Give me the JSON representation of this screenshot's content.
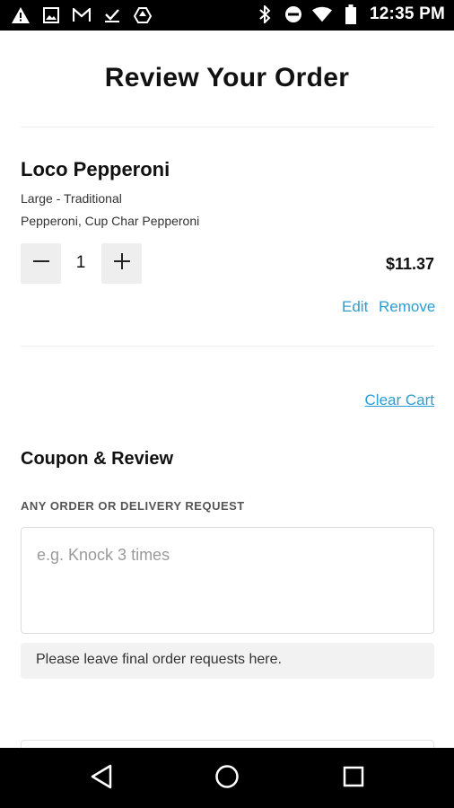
{
  "status_bar": {
    "time": "12:35 PM",
    "left_icons": [
      "warning-icon",
      "image-icon",
      "gmail-icon",
      "task-done-icon",
      "drive-icon"
    ],
    "right_icons": [
      "bluetooth-icon",
      "do-not-disturb-icon",
      "wifi-icon",
      "battery-icon"
    ]
  },
  "header": {
    "title": "Review Your Order"
  },
  "cart": {
    "items": [
      {
        "name": "Loco Pepperoni",
        "size": "Large - Traditional",
        "toppings": "Pepperoni, Cup Char Pepperoni",
        "quantity": "1",
        "price": "$11.37",
        "edit_label": "Edit",
        "remove_label": "Remove"
      }
    ],
    "clear_cart_label": "Clear Cart"
  },
  "coupon_review": {
    "title": "Coupon & Review",
    "request_label": "ANY ORDER OR DELIVERY REQUEST",
    "request_placeholder": "e.g. Knock 3 times",
    "request_value": "",
    "helper_text": "Please leave final order requests here."
  },
  "nav_bar": {
    "icons": [
      "back-icon",
      "home-icon",
      "recents-icon"
    ]
  },
  "colors": {
    "link": "#2a9ed6",
    "qty_button_bg": "#eeeeee",
    "status_bar_bg": "#000000"
  }
}
